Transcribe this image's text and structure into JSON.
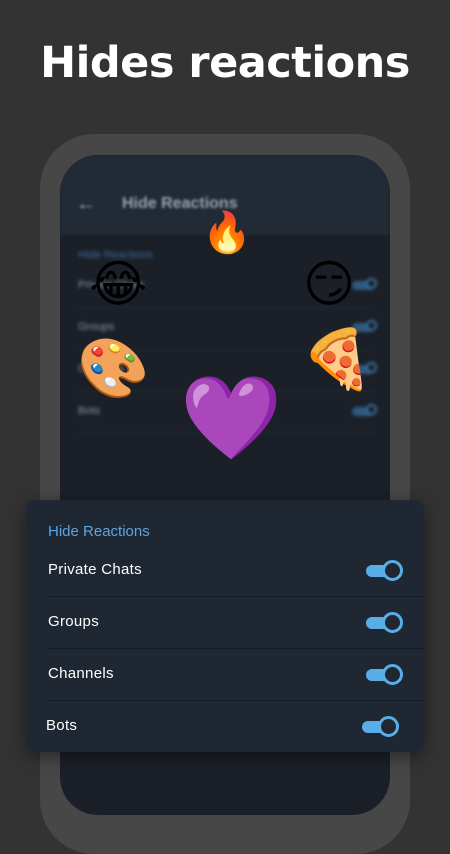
{
  "headline": "Hides reactions",
  "background_screen": {
    "title": "Hide Reactions",
    "section_header": "Hide Reactions",
    "rows": [
      "Private Chats",
      "Groups",
      "Channels",
      "Bots"
    ]
  },
  "decorative_emojis": {
    "fire": "🔥",
    "joy": "😂",
    "smirk": "😏",
    "palette": "🎨",
    "pizza": "🍕",
    "heart": "💜"
  },
  "panel": {
    "header": "Hide Reactions",
    "rows": [
      {
        "label": "Private Chats",
        "enabled": true
      },
      {
        "label": "Groups",
        "enabled": true
      },
      {
        "label": "Channels",
        "enabled": true
      },
      {
        "label": "Bots",
        "enabled": true
      }
    ]
  },
  "colors": {
    "background": "#333333",
    "accent": "#5aaee8",
    "panel": "#1f2732",
    "header_text": "#5aa6e6"
  }
}
